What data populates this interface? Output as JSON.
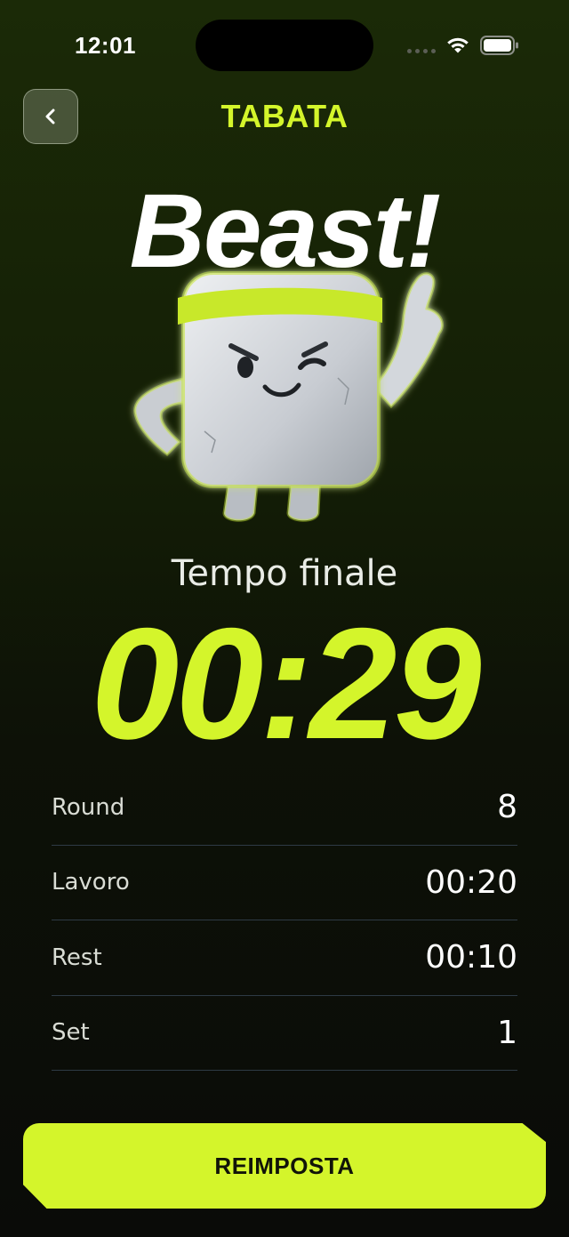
{
  "status_bar": {
    "time": "12:01",
    "icons": [
      "signal-dots-icon",
      "wifi-icon",
      "battery-icon"
    ]
  },
  "header": {
    "back_icon": "chevron-left-icon",
    "title": "TABATA"
  },
  "hero": {
    "headline": "Beast!",
    "mascot": "mascot-illustration"
  },
  "result": {
    "label": "Tempo finale",
    "time": "00:29"
  },
  "stats": [
    {
      "label": "Round",
      "value": "8"
    },
    {
      "label": "Lavoro",
      "value": "00:20"
    },
    {
      "label": "Rest",
      "value": "00:10"
    },
    {
      "label": "Set",
      "value": "1"
    }
  ],
  "actions": {
    "reset_label": "REIMPOSTA"
  },
  "colors": {
    "accent": "#d4f52b",
    "background_top": "#1b2a07",
    "background_bottom": "#0a0b08",
    "divider": "#2e3a45"
  }
}
